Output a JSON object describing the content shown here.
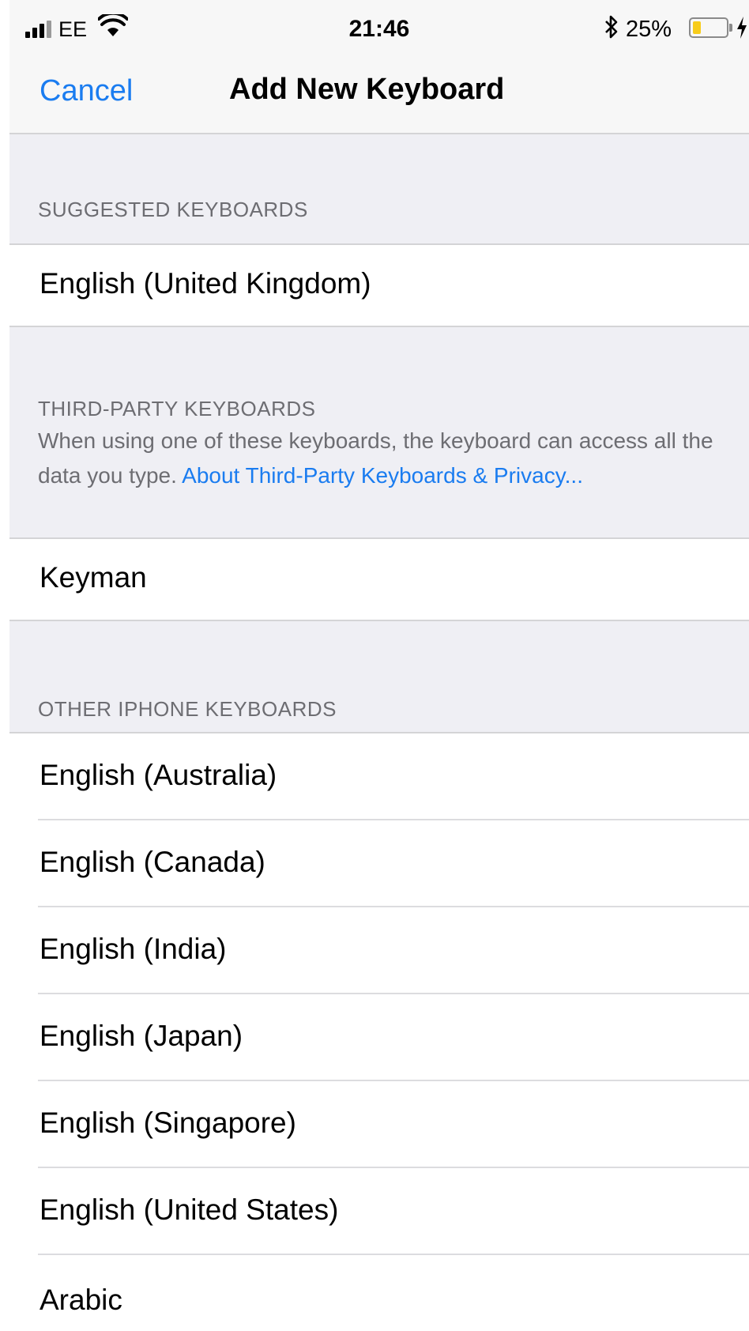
{
  "status_bar": {
    "carrier": "EE",
    "time": "21:46",
    "battery_percent": "25%",
    "battery_level": 0.25,
    "icons": [
      "signal-icon",
      "wifi-icon",
      "bluetooth-icon",
      "battery-icon",
      "charging-icon"
    ]
  },
  "nav": {
    "cancel": "Cancel",
    "title": "Add New Keyboard"
  },
  "sections": {
    "suggested": {
      "header": "SUGGESTED KEYBOARDS",
      "items": [
        "English (United Kingdom)"
      ]
    },
    "third_party": {
      "header": "THIRD-PARTY KEYBOARDS",
      "description": "When using one of these keyboards, the keyboard can access all the data you type.",
      "link": "About Third-Party Keyboards & Privacy...",
      "items": [
        "Keyman"
      ]
    },
    "other": {
      "header": "OTHER IPHONE KEYBOARDS",
      "items": [
        "English (Australia)",
        "English (Canada)",
        "English (India)",
        "English (Japan)",
        "English (Singapore)",
        "English (United States)",
        "Arabic"
      ]
    }
  },
  "colors": {
    "accent": "#1a7cf0",
    "grouped_background": "#efeff4",
    "section_text": "#6d6d72",
    "battery_fill": "#f7cc1b"
  }
}
